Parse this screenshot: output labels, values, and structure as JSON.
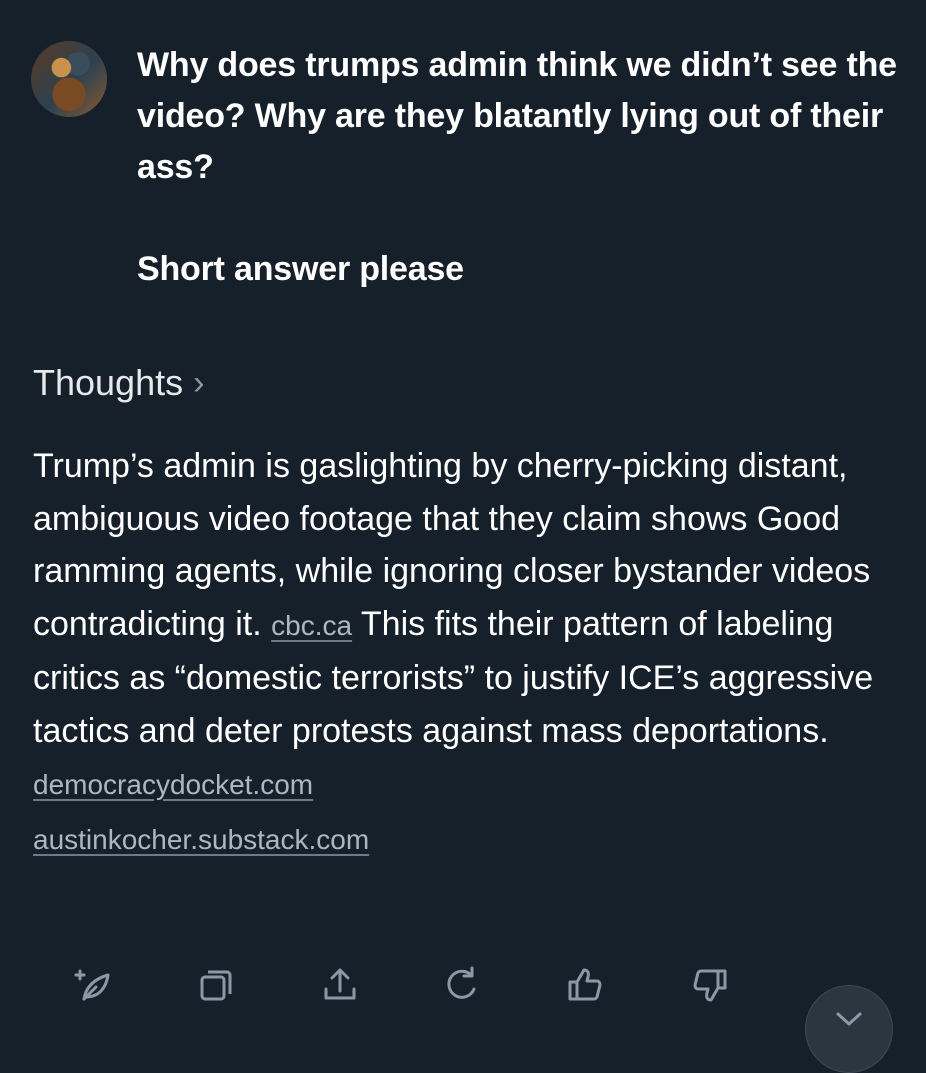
{
  "user_message": {
    "text": "Why does trumps admin think we didn’t see the video? Why are they blatantly lying out of their ass?\n\nShort answer please"
  },
  "thoughts": {
    "label": "Thoughts",
    "chevron": "›"
  },
  "answer": {
    "part1": "Trump’s admin is gaslighting by cherry-picking distant, ambiguous video footage that they claim shows Good ramming agents, while ignoring closer bystander videos contradicting it. ",
    "source1": "cbc.ca",
    "part2": " This fits their pattern of labeling critics as “domestic terrorists” to justify ICE’s aggressive tactics and deter protests against mass deportations. ",
    "source2": "democracydocket.com",
    "source3": "austinkocher.substack.com"
  },
  "toolbar": {
    "icons": [
      "sparkle-leaf-icon",
      "copy-icon",
      "share-icon",
      "regenerate-icon",
      "thumbs-up-icon",
      "thumbs-down-icon"
    ]
  },
  "colors": {
    "background": "#15202b",
    "text": "#ffffff",
    "muted": "#aab8c2",
    "icon": "#8b98a5"
  }
}
